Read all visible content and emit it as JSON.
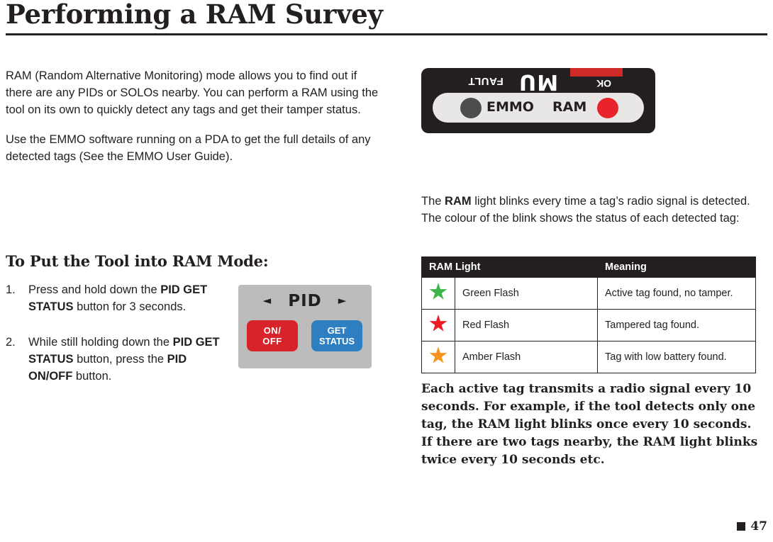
{
  "header": {
    "title": "Performing a RAM Survey"
  },
  "left": {
    "paragraph1": "RAM (Random Alternative Monitoring) mode allows you to find out if there are any PIDs or SOLOs nearby. You can perform a RAM using the tool on its own to quickly detect any tags and get their tamper status.",
    "paragraph2": "Use the EMMO software running on a PDA to get the full details of any detected tags (See the EMMO User Guide).",
    "subheading": "To Put the Tool into RAM Mode:",
    "steps": [
      {
        "number": "1.",
        "pre": "Press and hold down the ",
        "bold": "PID GET STATUS",
        "post": " button for 3 seconds."
      },
      {
        "number": "2.",
        "pre": "While still holding down the ",
        "bold": "PID GET STATUS",
        "mid": " button, press the ",
        "bold2": "PID ON/OFF",
        "post": " button."
      }
    ],
    "tool": {
      "left_arrow": "◄",
      "right_arrow": "►",
      "pid_label": "PID",
      "onoff_line1": "ON/",
      "onoff_line2": "OFF",
      "getstatus_line1": "GET",
      "getstatus_line2": "STATUS"
    }
  },
  "right": {
    "device": {
      "model": "MU",
      "fault_label": "FAULT",
      "ok_label": "OK",
      "emmo_label": "EMMO",
      "ram_label": "RAM"
    },
    "paragraph_pre": "The ",
    "paragraph_bold": "RAM",
    "paragraph_post": " light blinks every time a tag’s radio signal is detected. The colour of the blink shows the status of each detected tag:",
    "table": {
      "headers": [
        "RAM Light",
        "Meaning"
      ],
      "rows": [
        {
          "icon": "green-flash-star-icon",
          "color": "#3cb54a",
          "light": "Green Flash",
          "meaning": "Active tag found, no tamper."
        },
        {
          "icon": "red-flash-star-icon",
          "color": "#ed1c24",
          "light": "Red Flash",
          "meaning": "Tampered tag found."
        },
        {
          "icon": "amber-flash-star-icon",
          "color": "#f7941e",
          "light": "Amber Flash",
          "meaning": "Tag with low battery found."
        }
      ]
    },
    "closing": "Each active tag transmits a radio signal every 10 seconds. For example, if the tool detects only one tag, the RAM light blinks once every 10 seconds. If there are two tags nearby, the RAM light blinks twice every 10 seconds etc."
  },
  "footer": {
    "page_number": "47"
  }
}
